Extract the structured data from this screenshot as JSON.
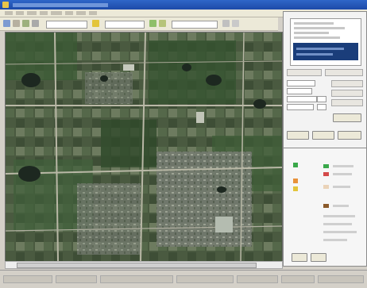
{
  "window": {
    "title": ""
  },
  "menu": {
    "items": [
      "",
      "",
      "",
      "",
      "",
      "",
      "",
      ""
    ]
  },
  "colors": {
    "titlebar": "#1f4eac",
    "selection": "#1a3d7a",
    "map_base": "#44543a",
    "accent_green": "#3aa84a",
    "accent_red": "#d44a4a",
    "accent_orange": "#e8923a",
    "accent_brown": "#8a5a2a",
    "accent_yellow": "#e3c53b"
  },
  "toolbar": {
    "icons": [
      "open-icon",
      "save-icon",
      "zoom-in-icon",
      "zoom-out-icon",
      "pan-icon",
      "select-icon",
      "measure-icon",
      "layer-icon",
      "refresh-icon"
    ]
  },
  "map": {
    "description_icon": "satellite-imagery"
  },
  "panel": {
    "list_selected": ""
  },
  "legend": {
    "swatch_names": [
      "green",
      "red",
      "orange",
      "brown",
      "yellow"
    ]
  }
}
